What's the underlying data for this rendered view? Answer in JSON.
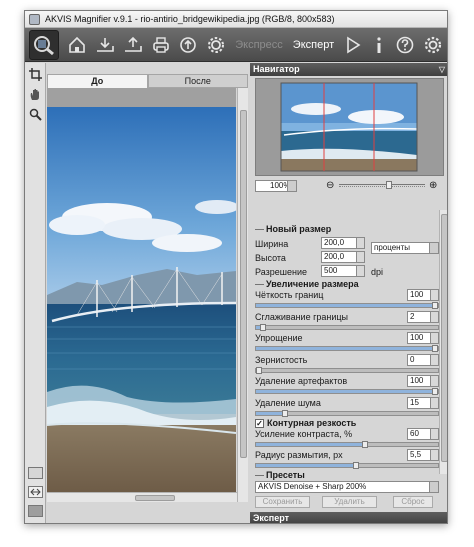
{
  "window": {
    "title": "AKVIS Magnifier v.9.1 - rio-antirio_bridgewikipedia.jpg (RGB/8, 800x583)"
  },
  "toolbar": {
    "icons": [
      "home-icon",
      "open-icon",
      "save-icon",
      "print-icon",
      "upload-icon",
      "settings-icon"
    ],
    "mode_express": "Экспресс",
    "mode_expert": "Эксперт",
    "right_icons": [
      "play-icon",
      "info-icon",
      "help-icon",
      "preferences-icon"
    ]
  },
  "left_tools": [
    "crop-icon",
    "hand-icon",
    "zoom-icon"
  ],
  "tabs": {
    "before": "До",
    "after": "После",
    "active": "before"
  },
  "navigator": {
    "title": "Навигатор",
    "zoom": "100%"
  },
  "new_size": {
    "title": "Новый размер",
    "width_label": "Ширина",
    "width_value": "200,0",
    "height_label": "Высота",
    "height_value": "200,0",
    "units": "проценты",
    "resolution_label": "Разрешение",
    "resolution_value": "500",
    "resolution_unit": "dpi"
  },
  "upscale": {
    "title": "Увеличение размера",
    "params": [
      {
        "label": "Чёткость границ",
        "value": "100",
        "level": 1.0
      },
      {
        "label": "Сглаживание границы",
        "value": "2",
        "level": 0.02
      },
      {
        "label": "Упрощение",
        "value": "100",
        "level": 1.0
      },
      {
        "label": "Зернистость",
        "value": "0",
        "level": 0.0
      },
      {
        "label": "Удаление артефактов",
        "value": "100",
        "level": 1.0
      },
      {
        "label": "Удаление шума",
        "value": "15",
        "level": 0.15
      }
    ]
  },
  "sharpness": {
    "title": "Контурная резкость",
    "enabled": true,
    "params": [
      {
        "label": "Усиление контраста, %",
        "value": "60",
        "level": 0.6
      },
      {
        "label": "Радиус размытия, px",
        "value": "5,5",
        "level": 0.55
      }
    ]
  },
  "presets": {
    "title": "Пресеты",
    "selected": "AKVIS Denoise + Sharp 200%",
    "save": "Сохранить",
    "delete": "Удалить",
    "reset": "Сброс"
  },
  "expert_bar": "Эксперт"
}
